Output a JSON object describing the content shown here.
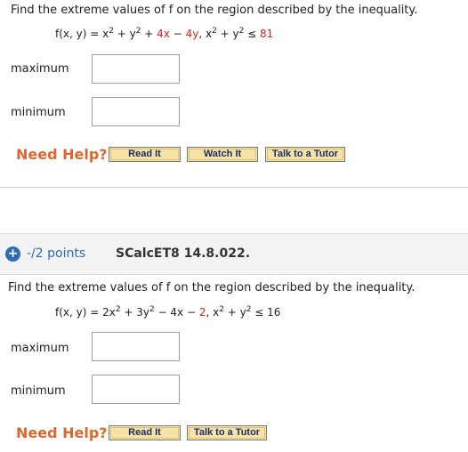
{
  "q1": {
    "prompt": "Find the extreme values of f on the region described by the inequality.",
    "formula": {
      "lhs": "f(x, y) = x",
      "p1": " + y",
      "p2": " + ",
      "c1": "4x",
      "p3": " − ",
      "c2": "4y",
      "p4": ",   x",
      "p5": " + y",
      "p6": " ≤ ",
      "rhs": "81",
      "exp": "2"
    },
    "maximum_label": "maximum",
    "minimum_label": "minimum",
    "maximum_value": "",
    "minimum_value": "",
    "need_help": "Need Help?",
    "buttons": [
      "Read It",
      "Watch It",
      "Talk to a Tutor"
    ]
  },
  "q2": {
    "plus_icon": "+",
    "points": "-/2 points",
    "code": "SCalcET8 14.8.022.",
    "prompt": "Find the extreme values of f on the region described by the inequality.",
    "formula": {
      "lhs": "f(x, y) = 2x",
      "p1": " + 3y",
      "p2": " − 4x − ",
      "c1": "2",
      "p3": ",   x",
      "p4": " + y",
      "p5": " ≤ 16",
      "exp": "2"
    },
    "maximum_label": "maximum",
    "minimum_label": "minimum",
    "maximum_value": "",
    "minimum_value": "",
    "need_help": "Need Help?",
    "buttons": [
      "Read It",
      "Talk to a Tutor"
    ]
  },
  "colors": {
    "accent": "#2d6db4",
    "help": "#e0672b",
    "highlight": "#d22",
    "button": "#f6e3a5"
  }
}
